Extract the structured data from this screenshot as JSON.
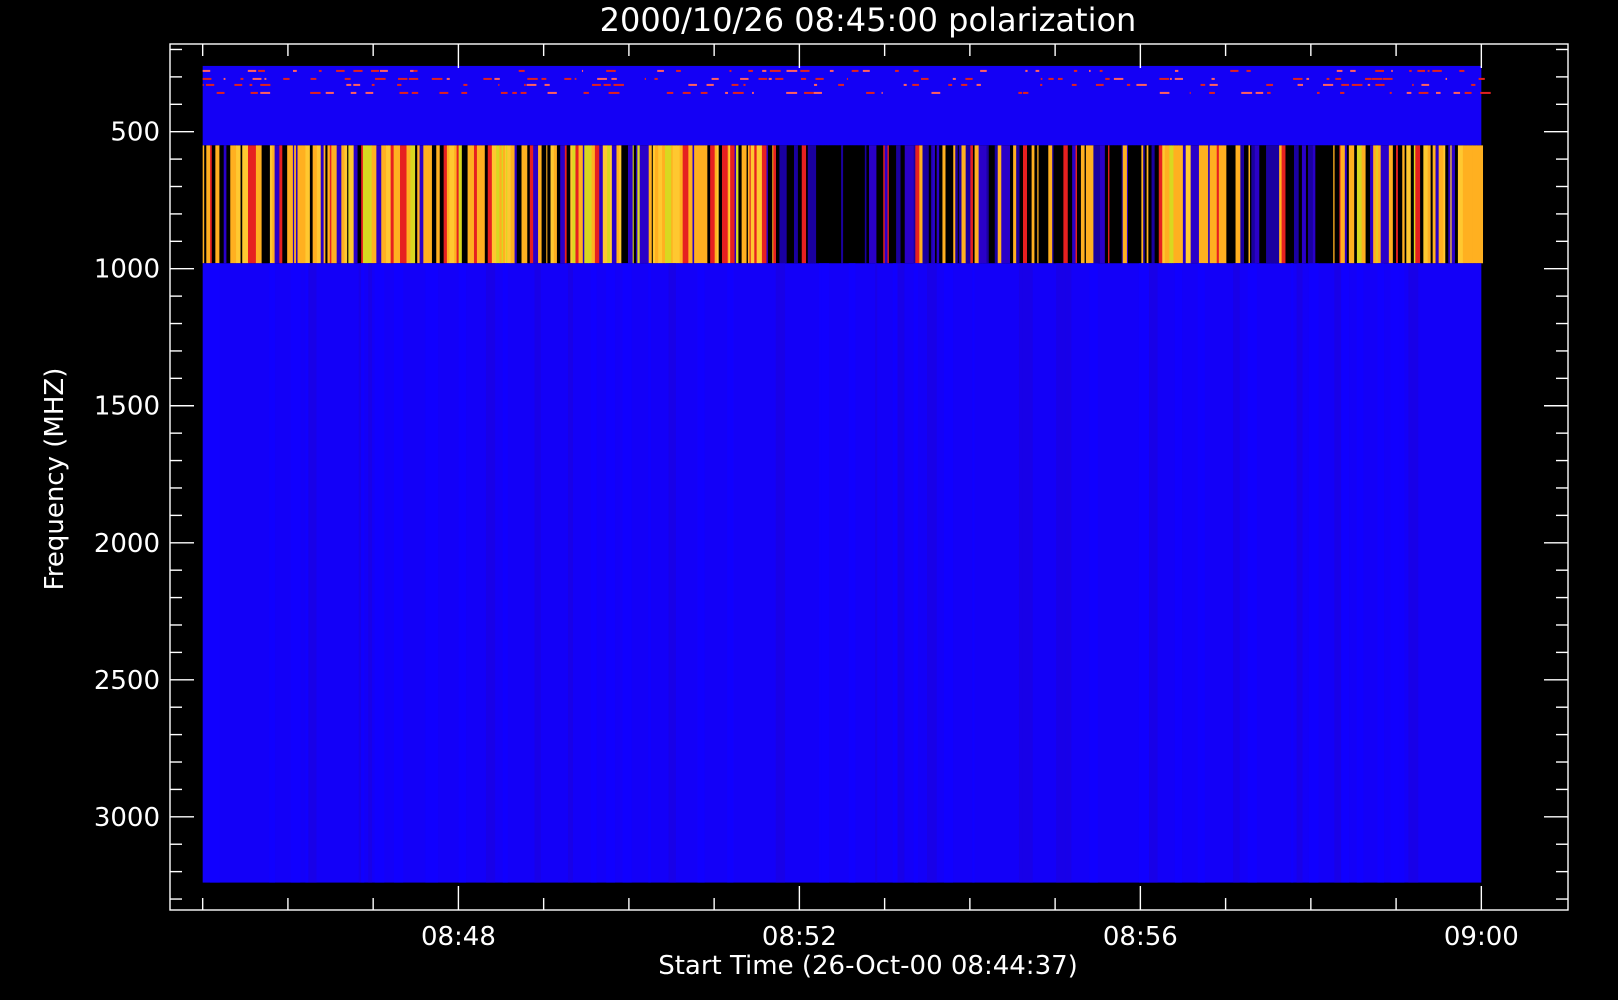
{
  "chart_data": {
    "type": "heatmap",
    "title": "2000/10/26 08:45:00 polarization",
    "xlabel": "Start Time (26-Oct-00 08:44:37)",
    "ylabel": "Frequency (MHZ)",
    "x_range": [
      "08:44:37",
      "09:01:01"
    ],
    "x_ticks": [
      {
        "label": "08:48",
        "value": "08:48:00"
      },
      {
        "label": "08:52",
        "value": "08:52:00"
      },
      {
        "label": "08:56",
        "value": "08:56:00"
      },
      {
        "label": "09:00",
        "value": "09:00:00"
      }
    ],
    "x_minor_ticks": [
      "08:45:00",
      "08:46:00",
      "08:47:00",
      "08:49:00",
      "08:50:00",
      "08:51:00",
      "08:53:00",
      "08:54:00",
      "08:55:00",
      "08:57:00",
      "08:58:00",
      "08:59:00"
    ],
    "data_time_range": [
      "08:45:00",
      "09:00:00"
    ],
    "y_range": [
      180,
      3340
    ],
    "y_reversed": true,
    "y_ticks": [
      {
        "label": "500",
        "value": 500
      },
      {
        "label": "1000",
        "value": 1000
      },
      {
        "label": "1500",
        "value": 1500
      },
      {
        "label": "2000",
        "value": 2000
      },
      {
        "label": "2500",
        "value": 2500
      },
      {
        "label": "3000",
        "value": 3000
      }
    ],
    "y_minor_ticks": [
      200,
      300,
      400,
      600,
      700,
      800,
      900,
      1100,
      1200,
      1300,
      1400,
      1600,
      1700,
      1800,
      1900,
      2100,
      2200,
      2300,
      2400,
      2600,
      2700,
      2800,
      2900,
      3100,
      3200,
      3300
    ],
    "bands": [
      {
        "freq_range": [
          260,
          550
        ],
        "color": "#1400f5",
        "pattern": "noisy-top"
      },
      {
        "freq_range": [
          550,
          980
        ],
        "color": "#000000",
        "pattern": "striped-burst"
      },
      {
        "freq_range": [
          980,
          3240
        ],
        "color": "#1300f8",
        "pattern": "uniform"
      }
    ],
    "burst_palette": [
      "#ffb020",
      "#ffc830",
      "#f5a000",
      "#e62020",
      "#cc1010",
      "#2a00c8",
      "#1a00a0",
      "#000000",
      "#d8d820"
    ],
    "grid": false
  }
}
